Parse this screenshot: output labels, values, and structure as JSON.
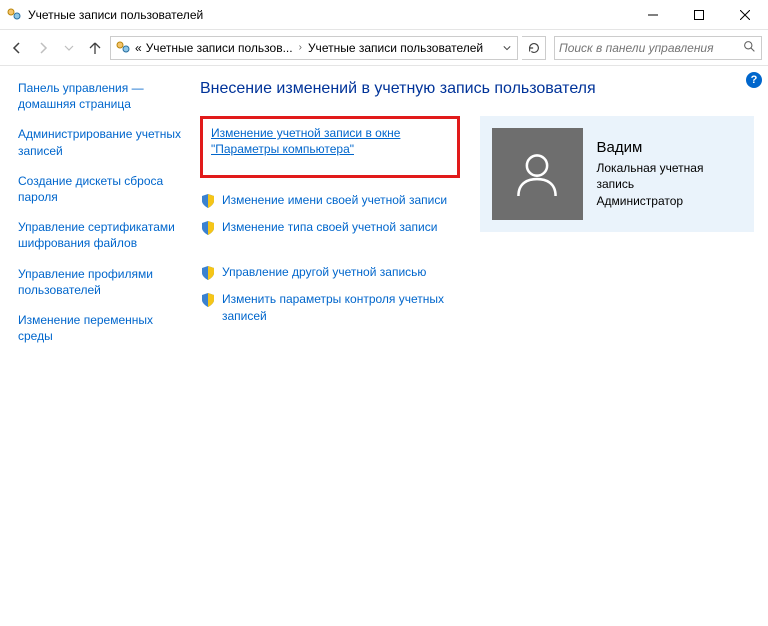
{
  "window": {
    "title": "Учетные записи пользователей"
  },
  "breadcrumb": {
    "prefix": "«",
    "item1": "Учетные записи пользов...",
    "item2": "Учетные записи пользователей"
  },
  "search": {
    "placeholder": "Поиск в панели управления"
  },
  "sidebar": {
    "items": [
      "Панель управления — домашняя страница",
      "Администрирование учетных записей",
      "Создание дискеты сброса пароля",
      "Управление сертификатами шифрования файлов",
      "Управление профилями пользователей",
      "Изменение переменных среды"
    ]
  },
  "main": {
    "title": "Внесение изменений в учетную запись пользователя",
    "highlight_link": "Изменение учетной записи в окне \"Параметры компьютера\"",
    "links": [
      "Изменение имени своей учетной записи",
      "Изменение типа своей учетной записи"
    ],
    "links2": [
      "Управление другой учетной записью",
      "Изменить параметры контроля учетных записей"
    ]
  },
  "account": {
    "name": "Вадим",
    "type": "Локальная учетная запись",
    "role": "Администратор"
  }
}
